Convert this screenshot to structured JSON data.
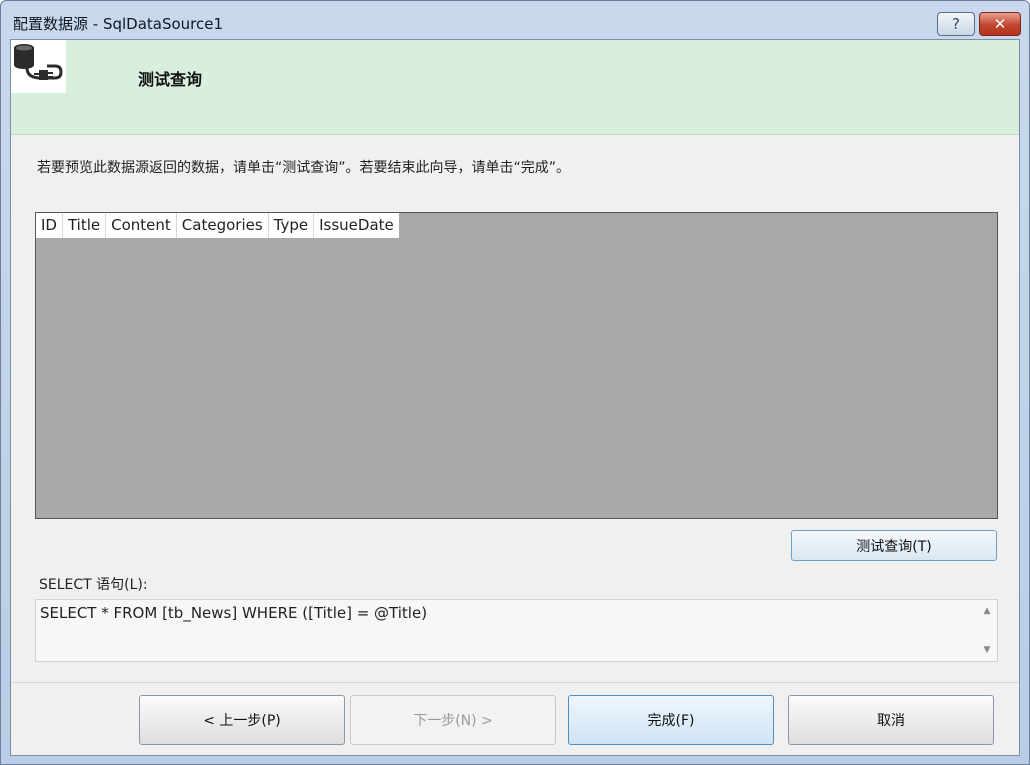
{
  "window": {
    "title": "配置数据源 - SqlDataSource1",
    "help_label": "?",
    "close_label": "✕"
  },
  "header": {
    "title": "测试查询",
    "icon": "database-connection-icon"
  },
  "instruction": "若要预览此数据源返回的数据，请单击“测试查询”。若要结束此向导，请单击“完成”。",
  "grid": {
    "columns": [
      "ID",
      "Title",
      "Content",
      "Categories",
      "Type",
      "IssueDate"
    ]
  },
  "buttons": {
    "test_query": "测试查询(T)",
    "previous": "< 上一步(P)",
    "next": "下一步(N) >",
    "finish": "完成(F)",
    "cancel": "取消"
  },
  "sql": {
    "label": "SELECT 语句(L):",
    "statement": "SELECT * FROM [tb_News] WHERE ([Title] = @Title)"
  },
  "colors": {
    "header_band": "#d8efde",
    "grid_background": "#a9a9a9",
    "close_button": "#c2452f"
  }
}
